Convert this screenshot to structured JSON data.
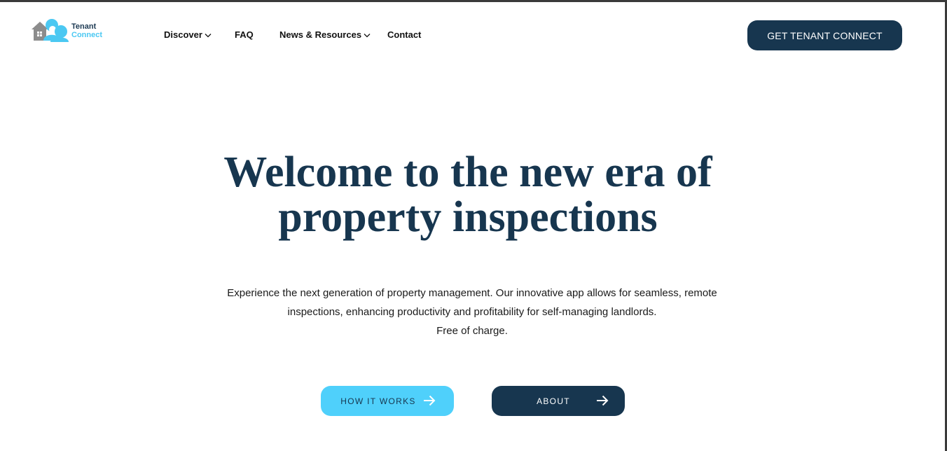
{
  "brand": {
    "line1": "Tenant",
    "line2": "Connect",
    "primary_color": "#17364f",
    "accent_color": "#4fd0fb"
  },
  "nav": {
    "items": [
      {
        "label": "Discover",
        "has_dropdown": true
      },
      {
        "label": "FAQ",
        "has_dropdown": false
      },
      {
        "label": "News & Resources",
        "has_dropdown": true
      },
      {
        "label": "Contact",
        "has_dropdown": false
      }
    ]
  },
  "header": {
    "cta_label": "GET TENANT CONNECT"
  },
  "hero": {
    "title_line1": "Welcome to the new era of",
    "title_line2": "property inspections",
    "sub_line1": "Experience the next generation of property management. Our innovative app allows for seamless, remote",
    "sub_line2": "inspections, enhancing productivity and profitability for self-managing landlords.",
    "sub_line3": "Free of charge."
  },
  "buttons": {
    "how_it_works": "HOW IT WORKS",
    "about": "ABOUT",
    "arrow_icon": "arrow-right-icon"
  }
}
